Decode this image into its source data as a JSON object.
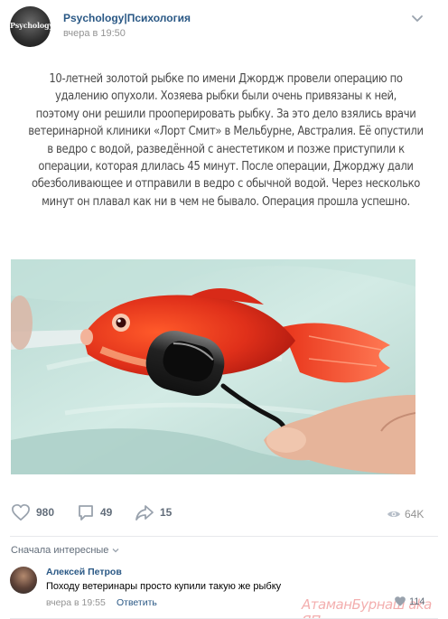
{
  "post": {
    "group_name": "Psychology|Психология",
    "time": "вчера в 19:50",
    "avatar_text": "Psychology",
    "text_lines": [
      "10-летней золотой рыбке по имени Джордж провели операцию по",
      "удалению опухоли. Хозяева рыбки были очень привязаны к ней,",
      "поэтому они решили прооперировать рыбку. За это дело взялись врачи",
      "ветеринарной клиники «Лорт Смит» в Мельбурне, Австралия. Её опустили",
      "в ведро с водой, разведённой с анестетиком и позже приступили к",
      "операции, которая длилась 45 минут. После операции, Джорджу дали",
      "обезболивающее и отправили в ведро с обычной водой. Через несколько",
      "минут он плавал как ни в чем не бывало. Операция прошла успешно."
    ]
  },
  "actions": {
    "likes": "980",
    "comments": "49",
    "shares": "15",
    "views": "64K"
  },
  "comments": {
    "sort_label": "Сначала интересные",
    "items": [
      {
        "author": "Алексей Петров",
        "text": "Походу ветеринары просто купили такую же рыбку",
        "time": "вчера в 19:55",
        "reply_label": "Ответить",
        "likes": "114"
      }
    ]
  },
  "watermark": "АтаманБурнаш aka ЯП",
  "icons": {
    "like": "heart-icon",
    "comment": "comment-bubble-icon",
    "share": "share-arrow-icon",
    "views": "eye-icon",
    "more": "chevron-down-icon"
  },
  "colors": {
    "link": "#2a5885",
    "meta": "#939393",
    "icon": "#99a2ad",
    "counter": "#626d7a"
  }
}
